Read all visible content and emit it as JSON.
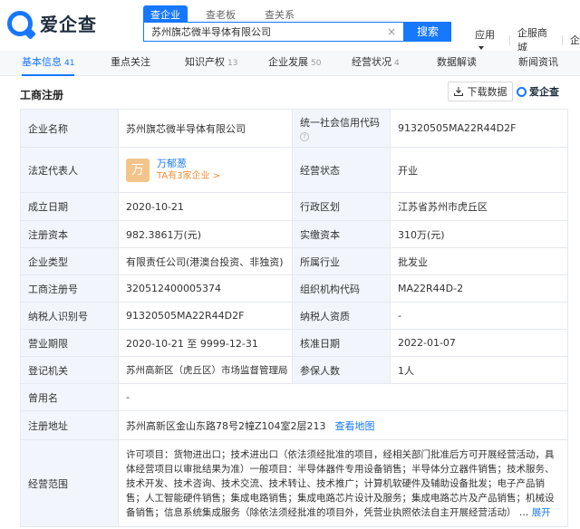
{
  "header": {
    "logo_text": "爱企查",
    "search_tabs": [
      "查企业",
      "查老板",
      "查关系"
    ],
    "search_value": "苏州旗芯微半导体有限公司",
    "search_button": "搜索",
    "links": [
      "应用",
      "企服商城",
      "企"
    ]
  },
  "nav": {
    "tabs": [
      {
        "label": "基本信息",
        "count": "41"
      },
      {
        "label": "重点关注",
        "count": ""
      },
      {
        "label": "知识产权",
        "count": "13"
      },
      {
        "label": "企业发展",
        "count": "50"
      },
      {
        "label": "经营状况",
        "count": "4"
      },
      {
        "label": "数据解读",
        "count": ""
      },
      {
        "label": "新闻资讯",
        "count": ""
      }
    ]
  },
  "section": {
    "title": "工商注册",
    "download_label": "下载数据",
    "brand": "爱企查"
  },
  "table": {
    "company_name_label": "企业名称",
    "company_name": "苏州旗芯微半导体有限公司",
    "credit_code_label": "统一社会信用代码",
    "credit_code": "91320505MA22R44D2F",
    "legal_rep_label": "法定代表人",
    "legal_rep_avatar": "万",
    "legal_rep_name": "万郁葱",
    "legal_rep_sub": "TA有3家企业 >",
    "status_label": "经营状态",
    "status": "开业",
    "founded_label": "成立日期",
    "founded": "2020-10-21",
    "district_label": "行政区划",
    "district": "江苏省苏州市虎丘区",
    "reg_capital_label": "注册资本",
    "reg_capital": "982.3861万(元)",
    "paid_capital_label": "实缴资本",
    "paid_capital": "310万(元)",
    "type_label": "企业类型",
    "type": "有限责任公司(港澳台投资、非独资)",
    "industry_label": "所属行业",
    "industry": "批发业",
    "reg_no_label": "工商注册号",
    "reg_no": "320512400005374",
    "org_code_label": "组织机构代码",
    "org_code": "MA22R44D-2",
    "taxpayer_id_label": "纳税人识别号",
    "taxpayer_id": "91320505MA22R44D2F",
    "taxpayer_qual_label": "纳税人资质",
    "taxpayer_qual": "-",
    "period_label": "营业期限",
    "period": "2020-10-21 至 9999-12-31",
    "approval_label": "核准日期",
    "approval": "2022-01-07",
    "authority_label": "登记机关",
    "authority": "苏州高新区（虎丘区）市场监督管理局",
    "insured_label": "参保人数",
    "insured": "1人",
    "former_name_label": "曾用名",
    "former_name": "-",
    "address_label": "注册地址",
    "address": "苏州高新区金山东路78号2幢Z104室2层213",
    "map_link": "查看地图",
    "scope_label": "经营范围",
    "scope": "许可项目：货物进出口；技术进出口（依法须经批准的项目，经相关部门批准后方可开展经营活动，具体经营项目以审批结果为准）一般项目：半导体器件专用设备销售；半导体分立器件销售；技术服务、技术开发、技术咨询、技术交流、技术转让、技术推广；计算机软硬件及辅助设备批发；电子产品销售；人工智能硬件销售；集成电路销售；集成电路芯片设计及服务；集成电路芯片及产品销售；机械设备销售；信息系统集成服务（除依法须经批准的项目外，凭营业执照依法自主开展经营活动）",
    "expand_label": "展开"
  }
}
